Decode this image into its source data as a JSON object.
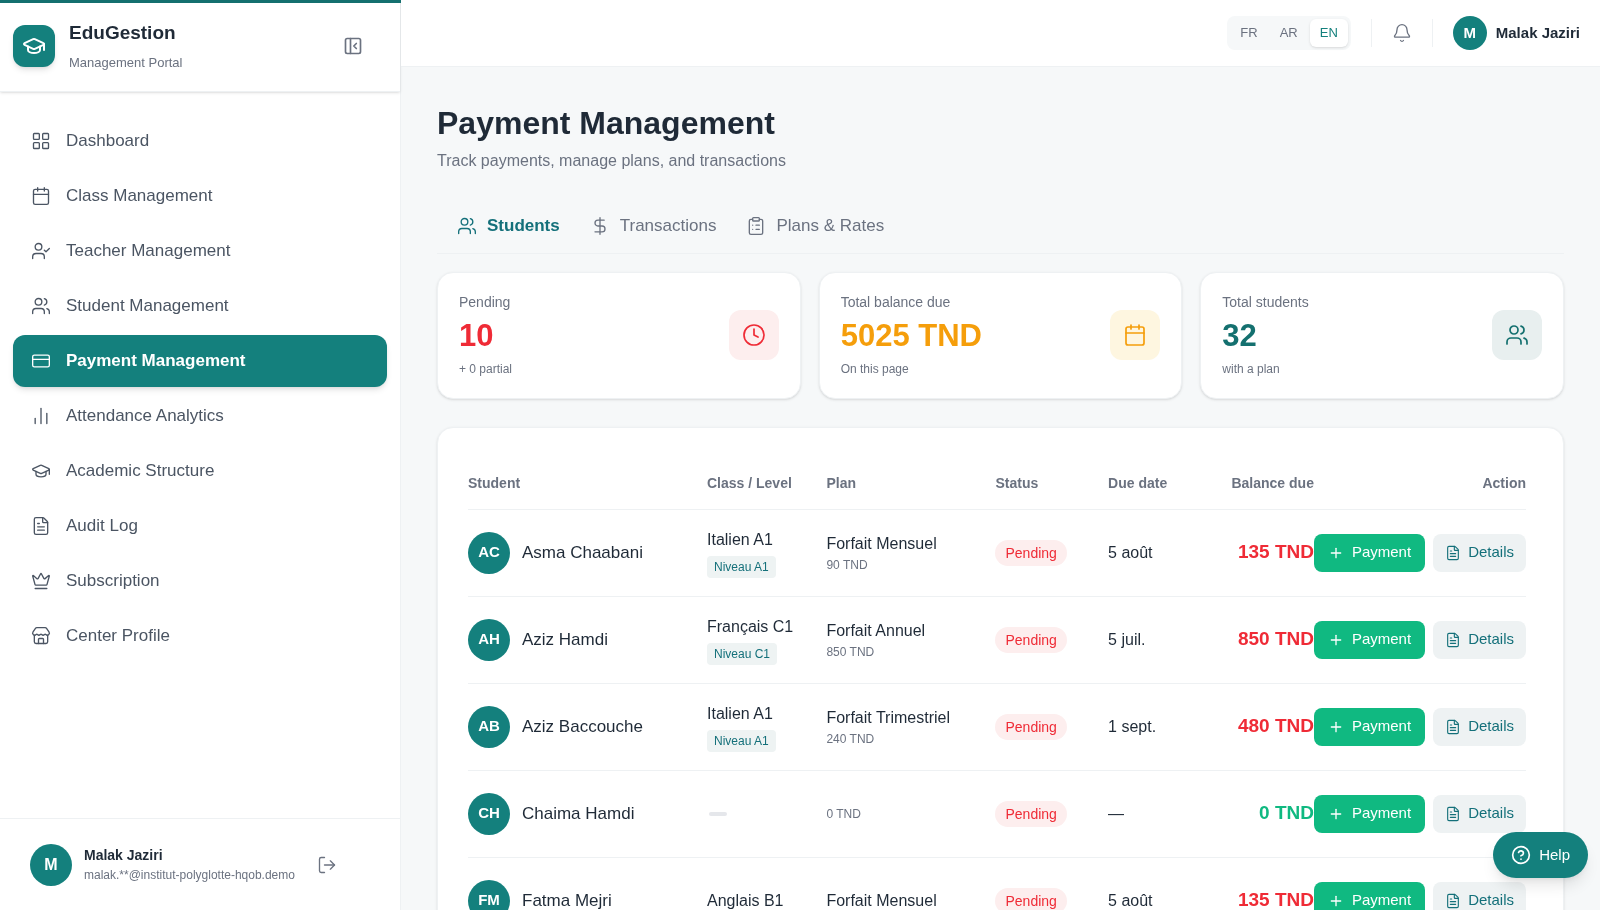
{
  "brand": {
    "name": "EduGestion",
    "subtitle": "Management Portal"
  },
  "sidebar": {
    "items": [
      {
        "label": "Dashboard",
        "selected": false
      },
      {
        "label": "Class Management",
        "selected": false
      },
      {
        "label": "Teacher Management",
        "selected": false
      },
      {
        "label": "Student Management",
        "selected": false
      },
      {
        "label": "Payment Management",
        "selected": true
      },
      {
        "label": "Attendance Analytics",
        "selected": false
      },
      {
        "label": "Academic Structure",
        "selected": false
      },
      {
        "label": "Audit Log",
        "selected": false
      },
      {
        "label": "Subscription",
        "selected": false
      },
      {
        "label": "Center Profile",
        "selected": false
      }
    ],
    "user": {
      "initial": "M",
      "name": "Malak Jaziri",
      "email": "malak.**@institut-polyglotte-hqob.demo"
    }
  },
  "header": {
    "languages": [
      {
        "label": "FR",
        "selected": false
      },
      {
        "label": "AR",
        "selected": false
      },
      {
        "label": "EN",
        "selected": true
      }
    ],
    "user": {
      "initial": "M",
      "name": "Malak Jaziri"
    }
  },
  "page": {
    "title": "Payment Management",
    "subtitle": "Track payments, manage plans, and transactions"
  },
  "tabs": [
    {
      "label": "Students",
      "selected": true
    },
    {
      "label": "Transactions",
      "selected": false
    },
    {
      "label": "Plans & Rates",
      "selected": false
    }
  ],
  "stats": [
    {
      "label": "Pending",
      "value": "10",
      "note": "+ 0 partial",
      "color": "#ef2b36"
    },
    {
      "label": "Total balance due",
      "value": "5025 TND",
      "note": "On this page",
      "color": "#f59e0b"
    },
    {
      "label": "Total students",
      "value": "32",
      "note": "with a plan",
      "color": "#14706f"
    }
  ],
  "table": {
    "columns": [
      "Student",
      "Class / Level",
      "Plan",
      "Status",
      "Due date",
      "Balance due",
      "Action"
    ],
    "rows": [
      {
        "initials": "AC",
        "name": "Asma Chaabani",
        "class": "Italien A1",
        "level": "Niveau A1",
        "plan": "Forfait Mensuel",
        "plan_price": "90 TND",
        "status": "Pending",
        "due": "5 août",
        "balance": "135 TND",
        "color": "#ef2b36",
        "payment": "Payment",
        "details": "Details"
      },
      {
        "initials": "AH",
        "name": "Aziz Hamdi",
        "class": "Français C1",
        "level": "Niveau C1",
        "plan": "Forfait Annuel",
        "plan_price": "850 TND",
        "status": "Pending",
        "due": "5 juil.",
        "balance": "850 TND",
        "color": "#ef2b36",
        "payment": "Payment",
        "details": "Details"
      },
      {
        "initials": "AB",
        "name": "Aziz Baccouche",
        "class": "Italien A1",
        "level": "Niveau A1",
        "plan": "Forfait Trimestriel",
        "plan_price": "240 TND",
        "status": "Pending",
        "due": "1 sept.",
        "balance": "480 TND",
        "color": "#ef2b36",
        "payment": "Payment",
        "details": "Details"
      },
      {
        "initials": "CH",
        "name": "Chaima Hamdi",
        "plan_price": "0 TND",
        "status": "Pending",
        "due": "—",
        "balance": "0 TND",
        "color": "#10b981",
        "payment": "Payment",
        "details": "Details"
      },
      {
        "initials": "FM",
        "name": "Fatma Mejri",
        "class": "Anglais B1",
        "plan": "Forfait Mensuel",
        "status": "Pending",
        "due": "5 août",
        "balance": "135 TND",
        "color": "#ef2b36",
        "payment": "Payment",
        "details": "Details"
      }
    ]
  },
  "help": {
    "label": "Help"
  }
}
